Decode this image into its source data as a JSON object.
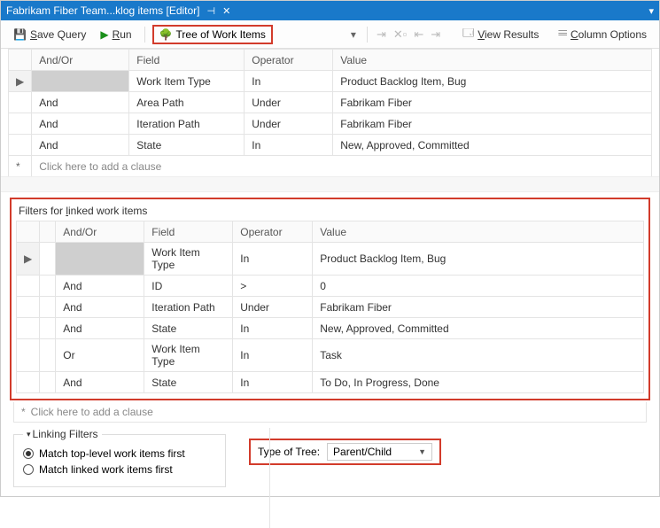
{
  "titlebar": {
    "tab_title": "Fabrikam Fiber Team...klog items [Editor]"
  },
  "toolbar": {
    "save_prefix": "S",
    "save_rest": "ave Query",
    "run_prefix": "R",
    "run_rest": "un",
    "tree_label": "Tree of Work Items",
    "view_results_prefix": "V",
    "view_results_rest": "iew Results",
    "column_options_prefix": "C",
    "column_options_rest": "olumn Options"
  },
  "headers": {
    "andor": "And/Or",
    "field": "Field",
    "operator": "Operator",
    "value": "Value"
  },
  "top_filters": [
    {
      "andor": "",
      "field": "Work Item Type",
      "operator": "In",
      "value": "Product Backlog Item, Bug",
      "selected": true,
      "andorSel": true
    },
    {
      "andor": "And",
      "field": "Area Path",
      "operator": "Under",
      "value": "Fabrikam Fiber"
    },
    {
      "andor": "And",
      "field": "Iteration Path",
      "operator": "Under",
      "value": "Fabrikam Fiber"
    },
    {
      "andor": "And",
      "field": "State",
      "operator": "In",
      "value": "New, Approved, Committed"
    }
  ],
  "add_clause": "Click here to add a clause",
  "linked": {
    "title_pre": "Filters for ",
    "title_under": "l",
    "title_post": "inked work items",
    "rows": [
      {
        "andor": "",
        "field": "Work Item Type",
        "operator": "In",
        "value": "Product Backlog Item, Bug",
        "selected": true,
        "andorSel": true
      },
      {
        "andor": "And",
        "field": "ID",
        "operator": ">",
        "value": "0"
      },
      {
        "andor": "And",
        "field": "Iteration Path",
        "operator": "Under",
        "value": "Fabrikam Fiber"
      },
      {
        "andor": "And",
        "field": "State",
        "operator": "In",
        "value": "New, Approved, Committed"
      },
      {
        "andor": "Or",
        "field": "Work Item Type",
        "operator": "In",
        "value": "Task"
      },
      {
        "andor": "And",
        "field": "State",
        "operator": "In",
        "value": "To Do, In Progress, Done"
      }
    ]
  },
  "linking_filters": {
    "legend": "Linking Filters",
    "opt1": "Match top-level work items first",
    "opt2": "Match linked work items first",
    "selected": 1
  },
  "type_of_tree": {
    "label_under": "T",
    "label_rest": "ype of Tree:",
    "value": "Parent/Child"
  }
}
